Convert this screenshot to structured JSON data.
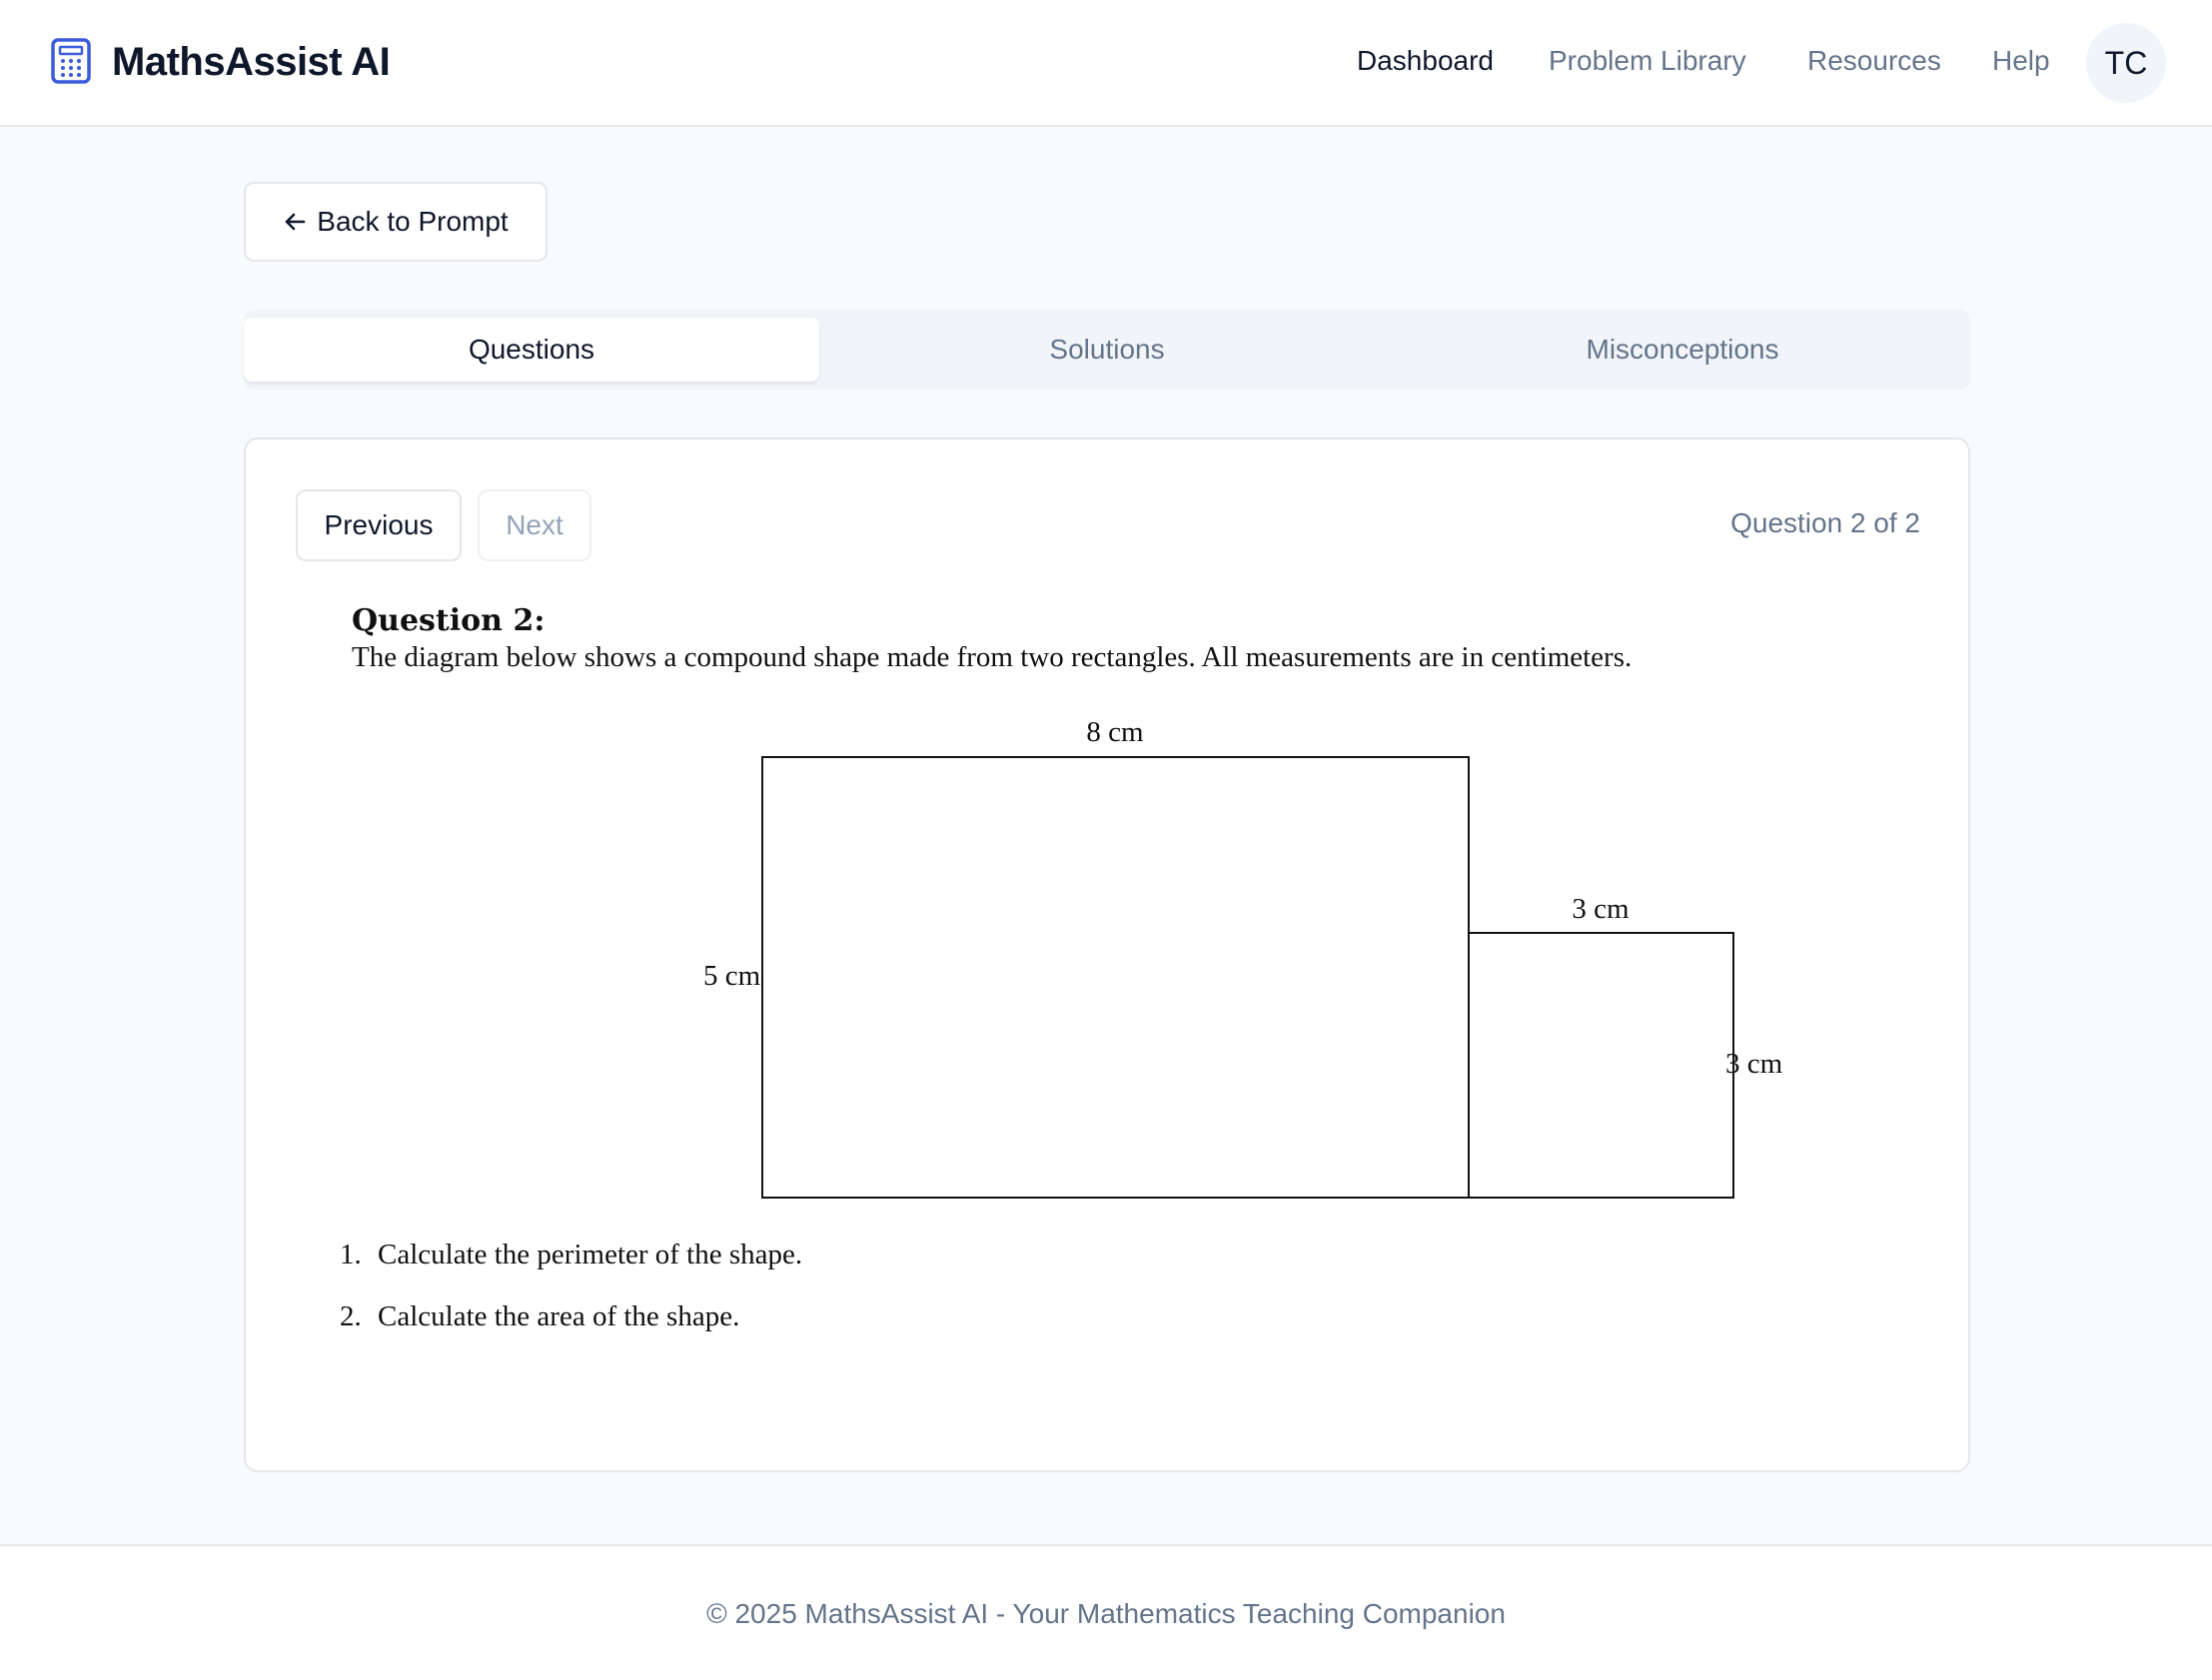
{
  "app": {
    "title": "MathsAssist AI",
    "logo_icon": "calculator-icon",
    "accent_color": "#3b5bdb"
  },
  "nav": {
    "items": [
      {
        "label": "Dashboard",
        "active": true
      },
      {
        "label": "Problem Library",
        "active": false
      },
      {
        "label": "Resources",
        "active": false
      },
      {
        "label": "Help",
        "active": false
      }
    ],
    "avatar_initials": "TC"
  },
  "back_button": {
    "label": "Back to Prompt",
    "icon": "arrow-left-icon"
  },
  "tabs": [
    {
      "label": "Questions",
      "active": true
    },
    {
      "label": "Solutions",
      "active": false
    },
    {
      "label": "Misconceptions",
      "active": false
    }
  ],
  "question_nav": {
    "previous_label": "Previous",
    "next_label": "Next",
    "next_disabled": true,
    "counter": "Question 2 of 2"
  },
  "question": {
    "title": "Question 2:",
    "text": "The diagram below shows a compound shape made from two rectangles.  All measurements are in centimeters.",
    "diagram_labels": {
      "top_width": "8 cm",
      "left_height": "5 cm",
      "small_width": "3 cm",
      "small_height": "3 cm"
    },
    "parts": [
      {
        "number": "1.",
        "text": "Calculate the perimeter of the shape."
      },
      {
        "number": "2.",
        "text": "Calculate the area of the shape."
      }
    ]
  },
  "footer": {
    "text": "© 2025 MathsAssist AI - Your Mathematics Teaching Companion"
  }
}
